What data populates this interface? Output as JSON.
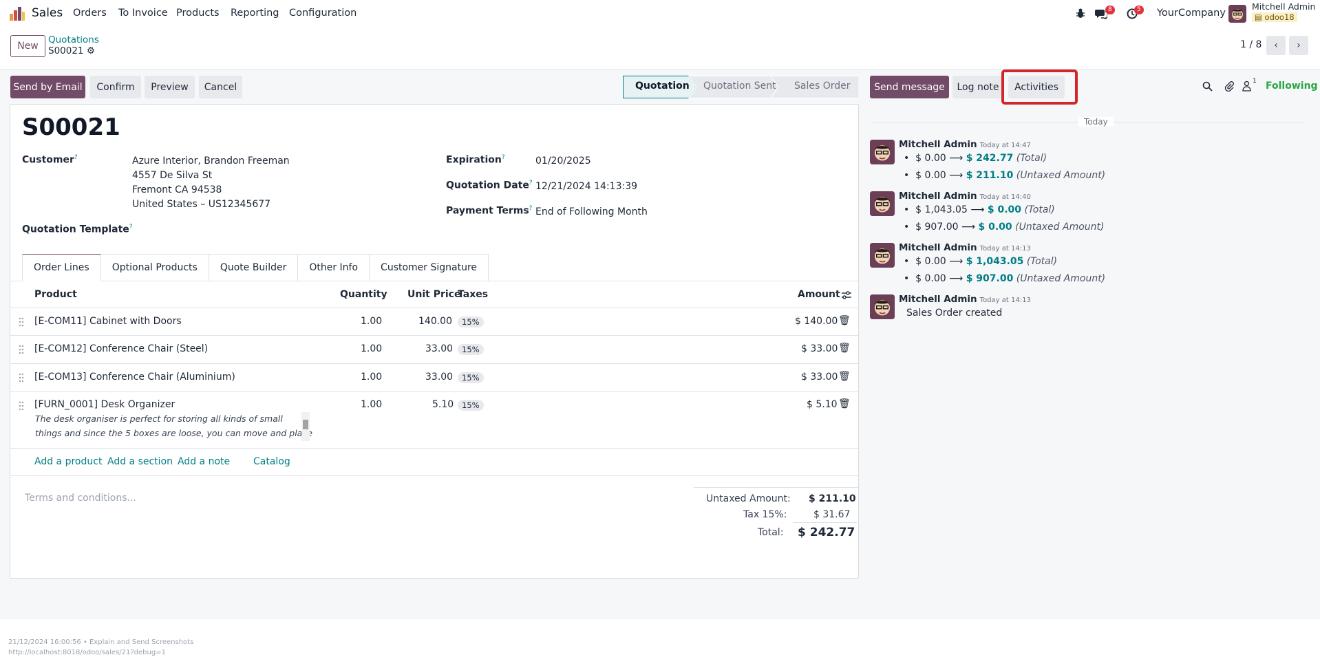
{
  "nav": {
    "app": "Sales",
    "menu": [
      "Orders",
      "To Invoice",
      "Products",
      "Reporting",
      "Configuration"
    ],
    "messages_count": "8",
    "activities_count": "5",
    "company": "YourCompany",
    "user": "Mitchell Admin",
    "db": "odoo18"
  },
  "control": {
    "new_label": "New",
    "breadcrumb_parent": "Quotations",
    "breadcrumb_current": "S00021",
    "pager": "1 / 8"
  },
  "actions": {
    "send_by_email": "Send by Email",
    "confirm": "Confirm",
    "preview": "Preview",
    "cancel": "Cancel"
  },
  "statusbar": [
    "Quotation",
    "Quotation Sent",
    "Sales Order"
  ],
  "form": {
    "title": "S00021",
    "customer_label": "Customer",
    "customer_lines": [
      "Azure Interior, Brandon Freeman",
      "4557 De Silva St",
      "Fremont CA 94538",
      "United States – US12345677"
    ],
    "template_label": "Quotation Template",
    "expiration_label": "Expiration",
    "expiration": "01/20/2025",
    "date_label": "Quotation Date",
    "date": "12/21/2024 14:13:39",
    "terms_label": "Payment Terms",
    "terms": "End of Following Month",
    "help": "?"
  },
  "tabs": [
    "Order Lines",
    "Optional Products",
    "Quote Builder",
    "Other Info",
    "Customer Signature"
  ],
  "table": {
    "headers": {
      "product": "Product",
      "quantity": "Quantity",
      "price": "Unit Price",
      "taxes": "Taxes",
      "amount": "Amount"
    },
    "rows": [
      {
        "product": "[E-COM11] Cabinet with Doors",
        "qty": "1.00",
        "price": "140.00",
        "tax": "15%",
        "amount": "$ 140.00"
      },
      {
        "product": "[E-COM12] Conference Chair (Steel)",
        "qty": "1.00",
        "price": "33.00",
        "tax": "15%",
        "amount": "$ 33.00"
      },
      {
        "product": "[E-COM13] Conference Chair (Aluminium)",
        "qty": "1.00",
        "price": "33.00",
        "tax": "15%",
        "amount": "$ 33.00"
      },
      {
        "product": "[FURN_0001] Desk Organizer",
        "qty": "1.00",
        "price": "5.10",
        "tax": "15%",
        "amount": "$ 5.10",
        "desc1": "The desk organiser is perfect for storing all kinds of small",
        "desc2": "things and since the 5 boxes are loose, you can move and place"
      }
    ],
    "add_product": "Add a product",
    "add_section": "Add a section",
    "add_note": "Add a note",
    "catalog": "Catalog"
  },
  "totals": {
    "terms_placeholder": "Terms and conditions...",
    "untaxed_label": "Untaxed Amount:",
    "untaxed": "$ 211.10",
    "tax_label": "Tax 15%:",
    "tax": "$ 31.67",
    "total_label": "Total:",
    "total": "$ 242.77"
  },
  "chatter": {
    "send_message": "Send message",
    "log_note": "Log note",
    "activities": "Activities",
    "followers_count": "1",
    "following": "Following",
    "day": "Today",
    "messages": [
      {
        "author": "Mitchell Admin",
        "time": "Today at 14:47",
        "lines": [
          {
            "old": "$ 0.00",
            "new": "$ 242.77",
            "field": "(Total)"
          },
          {
            "old": "$ 0.00",
            "new": "$ 211.10",
            "field": "(Untaxed Amount)"
          }
        ]
      },
      {
        "author": "Mitchell Admin",
        "time": "Today at 14:40",
        "lines": [
          {
            "old": "$ 1,043.05",
            "new": "$ 0.00",
            "field": "(Total)"
          },
          {
            "old": "$ 907.00",
            "new": "$ 0.00",
            "field": "(Untaxed Amount)"
          }
        ]
      },
      {
        "author": "Mitchell Admin",
        "time": "Today at 14:13",
        "lines": [
          {
            "old": "$ 0.00",
            "new": "$ 1,043.05",
            "field": "(Total)"
          },
          {
            "old": "$ 0.00",
            "new": "$ 907.00",
            "field": "(Untaxed Amount)"
          }
        ]
      },
      {
        "author": "Mitchell Admin",
        "time": "Today at 14:13",
        "text": "Sales Order created"
      }
    ]
  },
  "footer": {
    "line1": "21/12/2024 16:00:56 • Explain and Send Screenshots",
    "line2": "http://localhost:8018/odoo/sales/21?debug=1"
  },
  "colors": {
    "brand": "#714b67",
    "link": "#017e84",
    "highlight": "#d3262b"
  }
}
